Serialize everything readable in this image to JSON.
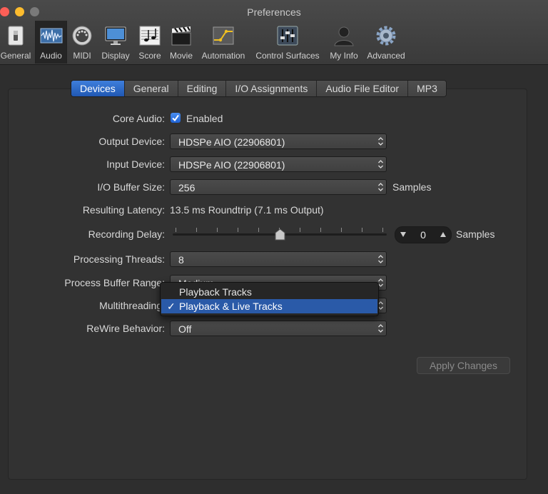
{
  "window": {
    "title": "Preferences"
  },
  "toolbar": {
    "items": [
      {
        "label": "General",
        "icon": "switch-icon"
      },
      {
        "label": "Audio",
        "icon": "waveform-icon"
      },
      {
        "label": "MIDI",
        "icon": "midi-port-icon"
      },
      {
        "label": "Display",
        "icon": "monitor-icon"
      },
      {
        "label": "Score",
        "icon": "music-notes-icon"
      },
      {
        "label": "Movie",
        "icon": "clapperboard-icon"
      },
      {
        "label": "Automation",
        "icon": "automation-icon"
      },
      {
        "label": "Control Surfaces",
        "icon": "mixer-faders-icon"
      },
      {
        "label": "My Info",
        "icon": "person-icon"
      },
      {
        "label": "Advanced",
        "icon": "gear-icon"
      }
    ],
    "selected": "Audio"
  },
  "tabs": [
    "Devices",
    "General",
    "Editing",
    "I/O Assignments",
    "Audio File Editor",
    "MP3"
  ],
  "active_tab": "Devices",
  "form": {
    "core_audio": {
      "label": "Core Audio:",
      "checkbox_label": "Enabled",
      "checked": true
    },
    "output_device": {
      "label": "Output Device:",
      "value": "HDSPe AIO (22906801)"
    },
    "input_device": {
      "label": "Input Device:",
      "value": "HDSPe AIO (22906801)"
    },
    "io_buffer": {
      "label": "I/O Buffer Size:",
      "value": "256",
      "unit": "Samples"
    },
    "latency": {
      "label": "Resulting Latency:",
      "value": "13.5 ms Roundtrip (7.1 ms Output)"
    },
    "recording_delay": {
      "label": "Recording Delay:",
      "value": "0",
      "unit": "Samples",
      "slider_fraction": 0.5
    },
    "processing_threads": {
      "label": "Processing Threads:",
      "value": "8"
    },
    "process_buffer_range": {
      "label": "Process Buffer Range:",
      "value": "Medium"
    },
    "multithreading": {
      "label": "Multithreading:"
    },
    "rewire": {
      "label": "ReWire Behavior:",
      "value": "Off"
    }
  },
  "multithreading_menu": {
    "options": [
      "Playback Tracks",
      "Playback & Live Tracks"
    ],
    "selected": "Playback & Live Tracks"
  },
  "apply_button": {
    "label": "Apply Changes",
    "enabled": false
  },
  "colors": {
    "accent": "#2a5aa8",
    "tab_active": "#2f6fd2",
    "background": "#2e2e2e"
  }
}
